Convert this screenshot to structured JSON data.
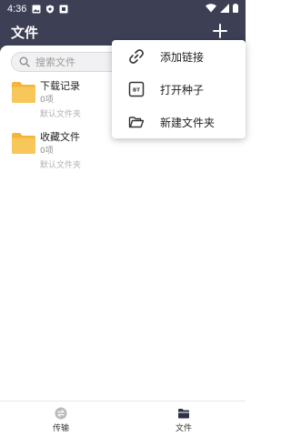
{
  "status_bar": {
    "time": "4:36"
  },
  "app_bar": {
    "title": "文件",
    "add_icon": "plus-icon"
  },
  "search": {
    "placeholder": "搜索文件"
  },
  "folders": [
    {
      "name": "下载记录",
      "count": "0项",
      "type": "默认文件夹"
    },
    {
      "name": "收藏文件",
      "count": "0项",
      "type": "默认文件夹"
    }
  ],
  "popup_menu": {
    "items": [
      {
        "label": "添加链接",
        "icon": "link-icon"
      },
      {
        "label": "打开种子",
        "icon": "bt-torrent-icon",
        "badge": "BT"
      },
      {
        "label": "新建文件夹",
        "icon": "folder-open-icon"
      }
    ]
  },
  "bottom_nav": {
    "tabs": [
      {
        "label": "传输",
        "icon": "transfer-icon",
        "active": false
      },
      {
        "label": "文件",
        "icon": "folder-icon",
        "active": true
      }
    ]
  },
  "colors": {
    "header": "#3d3f55",
    "folder": "#f7c04d"
  }
}
